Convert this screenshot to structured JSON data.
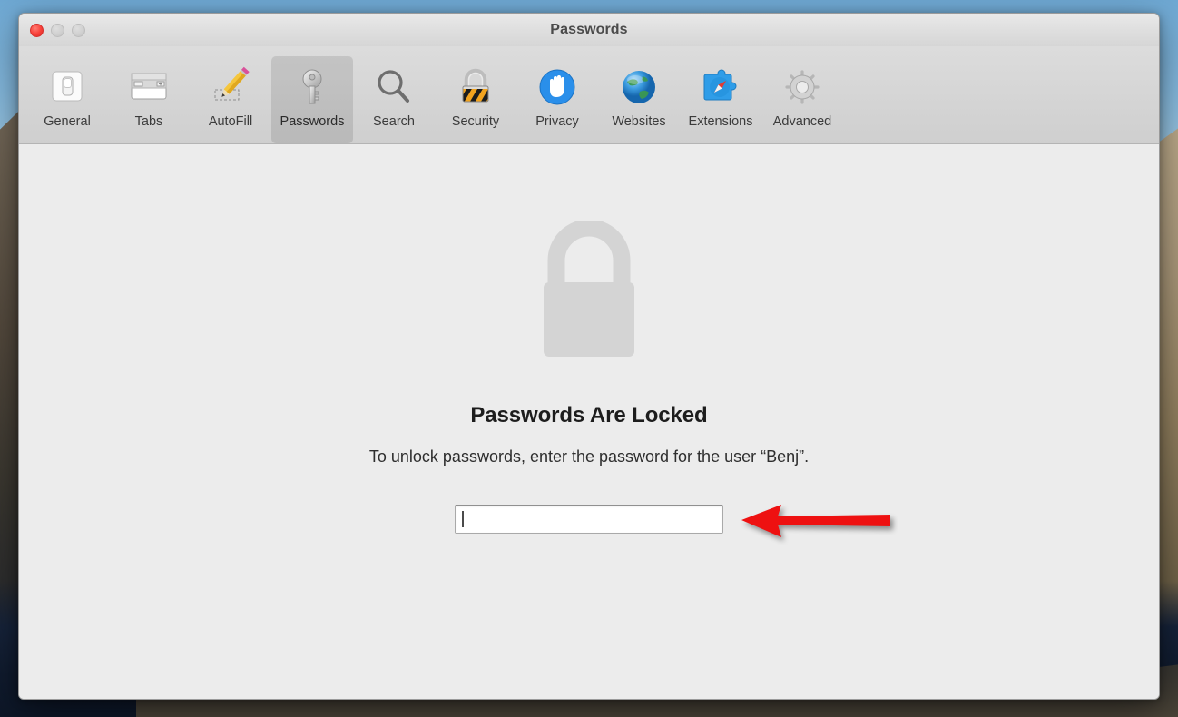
{
  "window": {
    "title": "Passwords",
    "controls": {
      "close_label": "Close",
      "minimize_label": "Minimize",
      "zoom_label": "Zoom"
    }
  },
  "toolbar": {
    "selected": "Passwords",
    "items": [
      {
        "label": "General",
        "icon": "switch-icon"
      },
      {
        "label": "Tabs",
        "icon": "tabs-icon"
      },
      {
        "label": "AutoFill",
        "icon": "pencil-icon"
      },
      {
        "label": "Passwords",
        "icon": "key-icon"
      },
      {
        "label": "Search",
        "icon": "magnifier-icon"
      },
      {
        "label": "Security",
        "icon": "padlock-hazard-icon"
      },
      {
        "label": "Privacy",
        "icon": "hand-icon"
      },
      {
        "label": "Websites",
        "icon": "globe-icon"
      },
      {
        "label": "Extensions",
        "icon": "puzzle-compass-icon"
      },
      {
        "label": "Advanced",
        "icon": "gear-icon"
      }
    ]
  },
  "main": {
    "lock_icon": "large-lock-icon",
    "heading": "Passwords Are Locked",
    "subtitle": "To unlock passwords, enter the password for the user “Benj”.",
    "password_field": {
      "value": "",
      "placeholder": "",
      "focused": true
    }
  },
  "annotation": {
    "arrow": "red-left-arrow",
    "color": "#ee1111",
    "points_to": "password-field"
  },
  "colors": {
    "window_chrome": "#dcdcdc",
    "content_background": "#ececec",
    "toolbar_selected": "rgba(0,0,0,0.10)",
    "heading_text": "#1d1d1d",
    "lock_gray": "#d4d4d4",
    "close_button": "#f8413a",
    "annotation_red": "#ee1111"
  }
}
